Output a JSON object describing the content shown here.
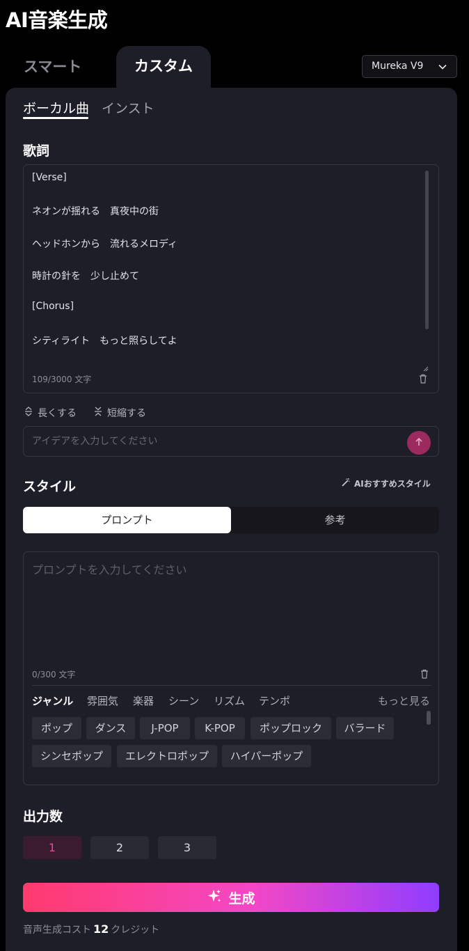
{
  "app": {
    "title": "AI音楽生成"
  },
  "mode_tabs": {
    "smart": "スマート",
    "custom": "カスタム"
  },
  "model_select": {
    "value": "Mureka V9"
  },
  "sub_tabs": {
    "vocal": "ボーカル曲",
    "inst": "インスト"
  },
  "lyrics": {
    "label": "歌詞",
    "lines": [
      "[Verse]",
      "ネオンが揺れる　真夜中の街",
      "ヘッドホンから　流れるメロディ",
      "時計の針を　少し止めて",
      "[Chorus]",
      "シティライト　もっと照らしてよ"
    ],
    "char_count": "109/3000 文字",
    "lengthen": "長くする",
    "shorten": "短縮する",
    "idea_placeholder": "アイデアを入力してください"
  },
  "style": {
    "label": "スタイル",
    "ai_recommend": "AIおすすめスタイル",
    "seg_prompt": "プロンプト",
    "seg_reference": "参考",
    "prompt_placeholder": "プロンプトを入力してください",
    "char_count": "0/300 文字",
    "categories": [
      "ジャンル",
      "雰囲気",
      "楽器",
      "シーン",
      "リズム",
      "テンポ"
    ],
    "more": "もっと見る",
    "chips": [
      "ポップ",
      "ダンス",
      "J-POP",
      "K-POP",
      "ポップロック",
      "バラード",
      "シンセポップ",
      "エレクトロポップ",
      "ハイパーポップ"
    ]
  },
  "output": {
    "label": "出力数",
    "options": [
      "1",
      "2",
      "3"
    ],
    "selected": "1"
  },
  "generate": {
    "label": "生成"
  },
  "cost": {
    "prefix": "音声生成コスト",
    "amount": "12",
    "suffix": "クレジット"
  },
  "colors": {
    "accent": "#e9489a",
    "panel": "#1e1e28",
    "gradient_start": "#ff3a6c",
    "gradient_end": "#8f3dff"
  },
  "icons": {
    "dropdown": "chevron-down-icon",
    "trash": "trash-icon",
    "lengthen": "expand-icon",
    "shorten": "collapse-icon",
    "send": "arrow-up-icon",
    "ai": "magic-wand-icon",
    "generate": "sparkle-icon"
  }
}
